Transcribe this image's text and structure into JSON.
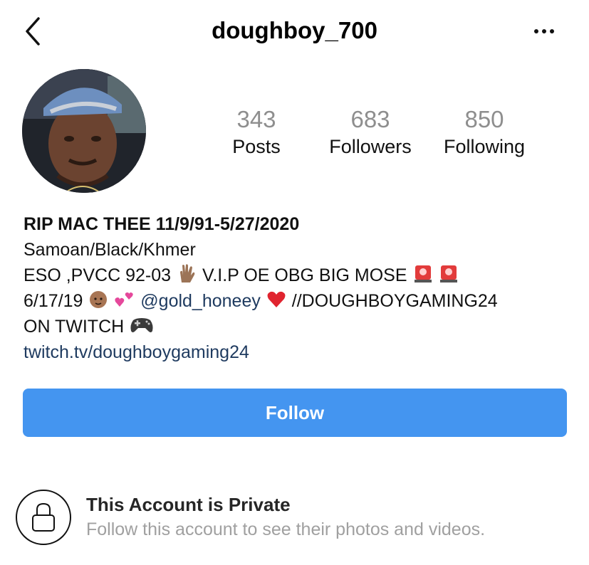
{
  "header": {
    "title": "doughboy_700",
    "back_icon": "chevron-left-icon",
    "more_icon": "more-horizontal-icon"
  },
  "stats": [
    {
      "count": "343",
      "label": "Posts"
    },
    {
      "count": "683",
      "label": "Followers"
    },
    {
      "count": "850",
      "label": "Following"
    }
  ],
  "bio": {
    "name": "RIP MAC THEE 11/9/91-5/27/2020",
    "line1": "Samoan/Black/Khmer",
    "line2_a": "ESO ,PVCC 92-03",
    "line2_b": " V.I.P OE OBG BIG MOSE",
    "line3_a": "6/17/19",
    "mention": "@gold_honeey",
    "line3_b": "//DOUGHBOYGAMING24",
    "line4": "ON TWITCH",
    "link": "twitch.tv/doughboygaming24"
  },
  "follow_button": {
    "label": "Follow"
  },
  "private": {
    "title": "This Account is Private",
    "subtitle": "Follow this account to see their photos and videos.",
    "icon": "lock-icon"
  },
  "colors": {
    "follow_bg": "#4495f0",
    "link": "#1e3a5f",
    "muted": "#8e8e8e"
  }
}
